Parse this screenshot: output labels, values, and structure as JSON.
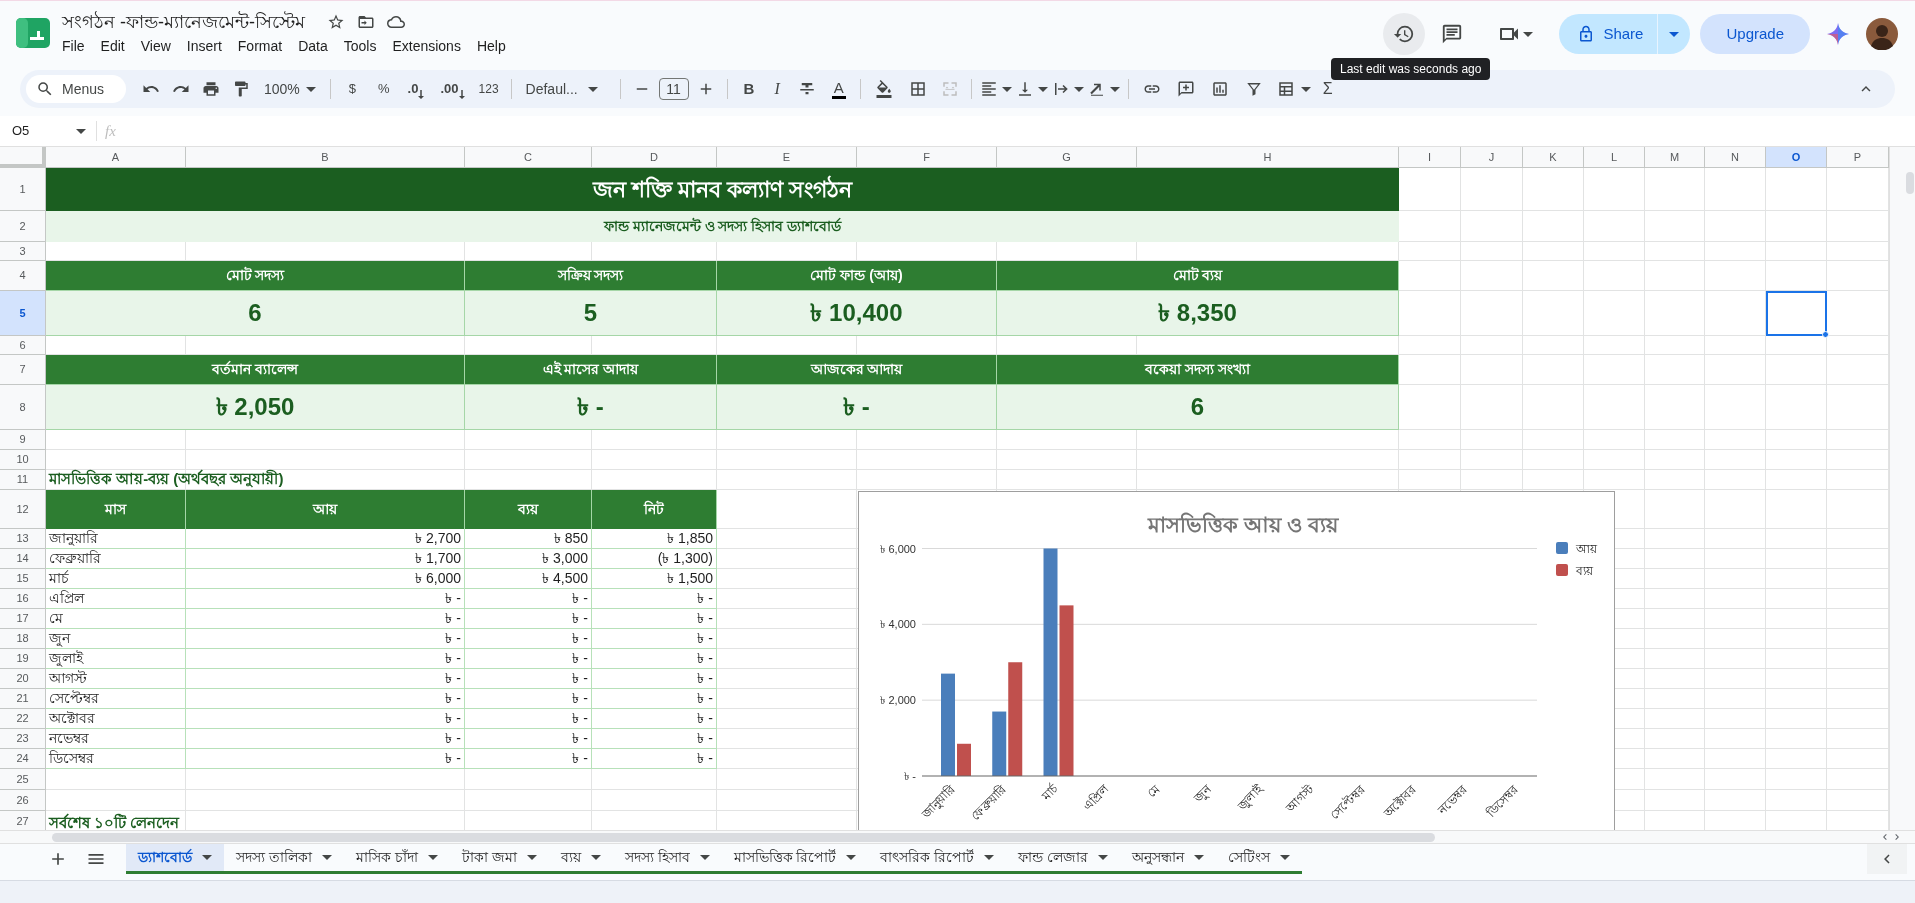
{
  "app": {
    "title": "সংগঠন -ফান্ড-ম্যানেজমেন্ট-সিস্টেম",
    "menu": [
      "File",
      "Edit",
      "View",
      "Insert",
      "Format",
      "Data",
      "Tools",
      "Extensions",
      "Help"
    ],
    "share": "Share",
    "upgrade": "Upgrade",
    "tooltip": "Last edit was seconds ago"
  },
  "toolbar": {
    "search": "Menus",
    "zoom": "100%",
    "currency": "$",
    "percent": "%",
    "decrease_decimals": ".0",
    "increase_decimals": ".00",
    "number_format": "123",
    "font": "Defaul...",
    "font_size": "11",
    "bold": "B",
    "italic": "I",
    "text_color": "A",
    "functions": "Σ"
  },
  "formula_bar": {
    "name_box": "O5",
    "fx": "fx"
  },
  "columns": [
    {
      "label": "A",
      "selected": false
    },
    {
      "label": "B",
      "selected": false
    },
    {
      "label": "C",
      "selected": false
    },
    {
      "label": "D",
      "selected": false
    },
    {
      "label": "E",
      "selected": false
    },
    {
      "label": "F",
      "selected": false
    },
    {
      "label": "G",
      "selected": false
    },
    {
      "label": "H",
      "selected": false
    },
    {
      "label": "I",
      "selected": false
    },
    {
      "label": "J",
      "selected": false
    },
    {
      "label": "K",
      "selected": false
    },
    {
      "label": "L",
      "selected": false
    },
    {
      "label": "M",
      "selected": false
    },
    {
      "label": "N",
      "selected": false
    },
    {
      "label": "O",
      "selected": true
    },
    {
      "label": "P",
      "selected": false
    }
  ],
  "rows": [
    {
      "label": "1",
      "selected": false
    },
    {
      "label": "2",
      "selected": false
    },
    {
      "label": "3",
      "selected": false
    },
    {
      "label": "4",
      "selected": false
    },
    {
      "label": "5",
      "selected": true
    },
    {
      "label": "6",
      "selected": false
    },
    {
      "label": "7",
      "selected": false
    },
    {
      "label": "8",
      "selected": false
    },
    {
      "label": "9",
      "selected": false
    },
    {
      "label": "10",
      "selected": false
    },
    {
      "label": "11",
      "selected": false
    },
    {
      "label": "12",
      "selected": false
    },
    {
      "label": "13",
      "selected": false
    },
    {
      "label": "14",
      "selected": false
    },
    {
      "label": "15",
      "selected": false
    },
    {
      "label": "16",
      "selected": false
    },
    {
      "label": "17",
      "selected": false
    },
    {
      "label": "18",
      "selected": false
    },
    {
      "label": "19",
      "selected": false
    },
    {
      "label": "20",
      "selected": false
    },
    {
      "label": "21",
      "selected": false
    },
    {
      "label": "22",
      "selected": false
    },
    {
      "label": "23",
      "selected": false
    },
    {
      "label": "24",
      "selected": false
    },
    {
      "label": "25",
      "selected": false
    },
    {
      "label": "26",
      "selected": false
    },
    {
      "label": "27",
      "selected": false
    }
  ],
  "dashboard": {
    "title": "জন শক্তি মানব কল্যাণ সংগঠন",
    "subtitle": "ফান্ড ম্যানেজমেন্ট ও সদস্য হিসাব ড্যাশবোর্ড",
    "stat_rows": [
      {
        "cards": [
          {
            "label": "মোট সদস্য",
            "value": "6"
          },
          {
            "label": "সক্রিয় সদস্য",
            "value": "5"
          },
          {
            "label": "মোট ফান্ড (আয়)",
            "value": "৳ 10,400"
          },
          {
            "label": "মোট ব্যয়",
            "value": "৳ 8,350"
          }
        ]
      },
      {
        "cards": [
          {
            "label": "বর্তমান ব্যালেন্স",
            "value": "৳ 2,050"
          },
          {
            "label": "এই মাসের আদায়",
            "value": "৳ -"
          },
          {
            "label": "আজকের আদায়",
            "value": "৳ -"
          },
          {
            "label": "বকেয়া সদস্য সংখ্যা",
            "value": "6"
          }
        ]
      }
    ]
  },
  "monthly": {
    "heading": "মাসভিত্তিক আয়-ব্যয় (অর্থবছর অনুযায়ী)",
    "columns": [
      "মাস",
      "আয়",
      "ব্যয়",
      "নিট"
    ],
    "rows": [
      {
        "month": "জানুয়ারি",
        "income": "৳ 2,700",
        "expense": "৳ 850",
        "net": "৳ 1,850"
      },
      {
        "month": "ফেব্রুয়ারি",
        "income": "৳ 1,700",
        "expense": "৳ 3,000",
        "net": "(৳ 1,300)"
      },
      {
        "month": "মার্চ",
        "income": "৳ 6,000",
        "expense": "৳ 4,500",
        "net": "৳ 1,500"
      },
      {
        "month": "এপ্রিল",
        "income": "৳ -",
        "expense": "৳ -",
        "net": "৳ -"
      },
      {
        "month": "মে",
        "income": "৳ -",
        "expense": "৳ -",
        "net": "৳ -"
      },
      {
        "month": "জুন",
        "income": "৳ -",
        "expense": "৳ -",
        "net": "৳ -"
      },
      {
        "month": "জুলাই",
        "income": "৳ -",
        "expense": "৳ -",
        "net": "৳ -"
      },
      {
        "month": "আগস্ট",
        "income": "৳ -",
        "expense": "৳ -",
        "net": "৳ -"
      },
      {
        "month": "সেপ্টেম্বর",
        "income": "৳ -",
        "expense": "৳ -",
        "net": "৳ -"
      },
      {
        "month": "অক্টোবর",
        "income": "৳ -",
        "expense": "৳ -",
        "net": "৳ -"
      },
      {
        "month": "নভেম্বর",
        "income": "৳ -",
        "expense": "৳ -",
        "net": "৳ -"
      },
      {
        "month": "ডিসেম্বর",
        "income": "৳ -",
        "expense": "৳ -",
        "net": "৳ -"
      }
    ]
  },
  "recent_heading": "সর্বশেষ ১০টি লেনদেন",
  "chart": {
    "chart_data": {
      "type": "bar",
      "title": "মাসভিত্তিক আয় ও ব্যয়",
      "categories": [
        "জানুয়ারি",
        "ফেব্রুয়ারি",
        "মার্চ",
        "এপ্রিল",
        "মে",
        "জুন",
        "জুলাই",
        "আগস্ট",
        "সেপ্টেম্বর",
        "অক্টোবর",
        "নভেম্বর",
        "ডিসেম্বর"
      ],
      "series": [
        {
          "name": "আয়",
          "color": "#4a7ebb",
          "values": [
            2700,
            1700,
            6000,
            0,
            0,
            0,
            0,
            0,
            0,
            0,
            0,
            0
          ]
        },
        {
          "name": "ব্যয়",
          "color": "#c0504d",
          "values": [
            850,
            3000,
            4500,
            0,
            0,
            0,
            0,
            0,
            0,
            0,
            0,
            0
          ]
        }
      ],
      "legend": "right",
      "ylim": [
        0,
        6000
      ],
      "yticks": [
        {
          "value": 0,
          "label": "৳ -"
        },
        {
          "value": 2000,
          "label": "৳ 2,000"
        },
        {
          "value": 4000,
          "label": "৳ 4,000"
        },
        {
          "value": 6000,
          "label": "৳ 6,000"
        }
      ]
    }
  },
  "sheet_tabs": [
    {
      "label": "ড্যাশবোর্ড",
      "selected": true
    },
    {
      "label": "সদস্য তালিকা",
      "selected": false
    },
    {
      "label": "মাসিক চাঁদা",
      "selected": false
    },
    {
      "label": "টাকা জমা",
      "selected": false
    },
    {
      "label": "ব্যয়",
      "selected": false
    },
    {
      "label": "সদস্য হিসাব",
      "selected": false
    },
    {
      "label": "মাসভিত্তিক রিপোর্ট",
      "selected": false
    },
    {
      "label": "বাৎসরিক রিপোর্ট",
      "selected": false
    },
    {
      "label": "ফান্ড লেজার",
      "selected": false
    },
    {
      "label": "অনুসন্ধান",
      "selected": false
    },
    {
      "label": "সেটিংস",
      "selected": false
    }
  ]
}
